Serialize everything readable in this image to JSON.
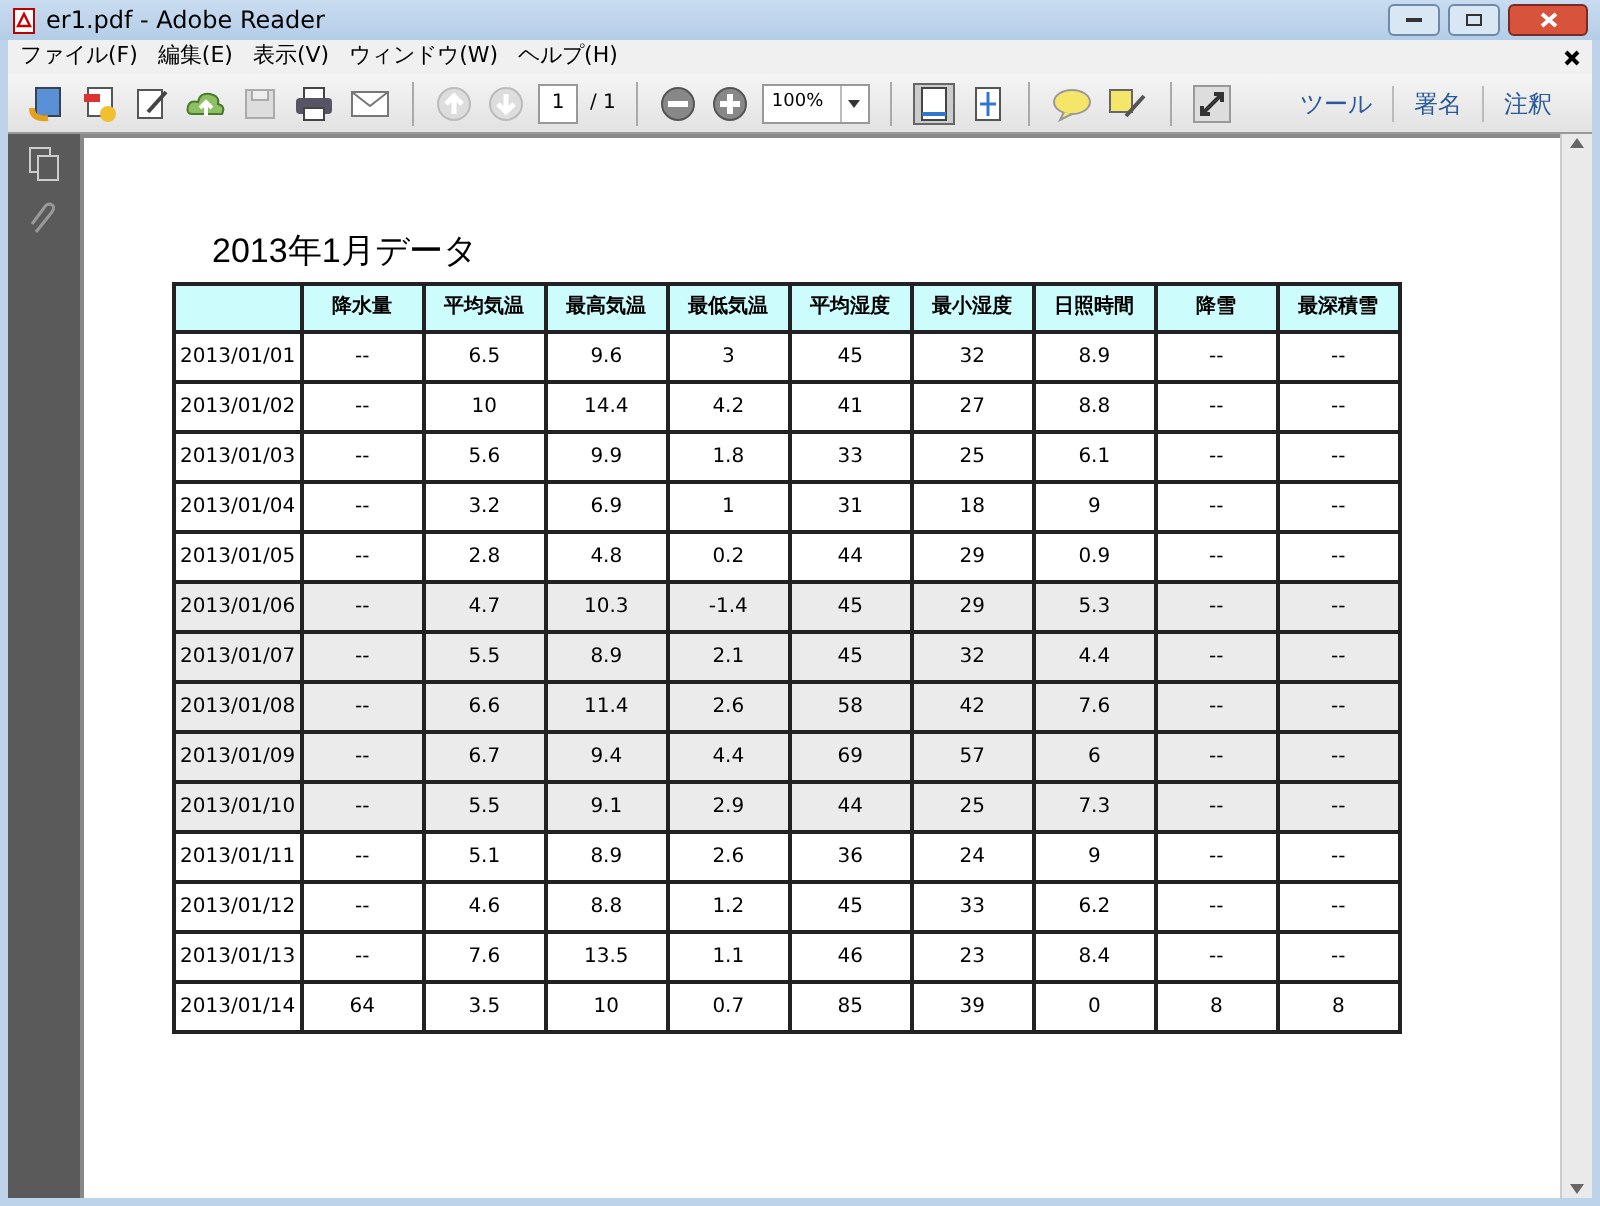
{
  "window": {
    "title": "er1.pdf - Adobe Reader"
  },
  "menu": [
    "ファイル(F)",
    "編集(E)",
    "表示(V)",
    "ウィンドウ(W)",
    "ヘルプ(H)"
  ],
  "toolbar": {
    "page": "1",
    "page_total": "/ 1",
    "zoom": "100%",
    "panels": [
      "ツール",
      "署名",
      "注釈"
    ]
  },
  "document": {
    "title": "2013年1月データ",
    "table": {
      "columns": [
        "",
        "降水量",
        "平均気温",
        "最高気温",
        "最低気温",
        "平均湿度",
        "最小湿度",
        "日照時間",
        "降雪",
        "最深積雪"
      ],
      "rows": [
        {
          "highlighted": false,
          "cells": [
            "2013/01/01",
            "--",
            "6.5",
            "9.6",
            "3",
            "45",
            "32",
            "8.9",
            "--",
            "--"
          ]
        },
        {
          "highlighted": false,
          "cells": [
            "2013/01/02",
            "--",
            "10",
            "14.4",
            "4.2",
            "41",
            "27",
            "8.8",
            "--",
            "--"
          ]
        },
        {
          "highlighted": false,
          "cells": [
            "2013/01/03",
            "--",
            "5.6",
            "9.9",
            "1.8",
            "33",
            "25",
            "6.1",
            "--",
            "--"
          ]
        },
        {
          "highlighted": false,
          "cells": [
            "2013/01/04",
            "--",
            "3.2",
            "6.9",
            "1",
            "31",
            "18",
            "9",
            "--",
            "--"
          ]
        },
        {
          "highlighted": false,
          "cells": [
            "2013/01/05",
            "--",
            "2.8",
            "4.8",
            "0.2",
            "44",
            "29",
            "0.9",
            "--",
            "--"
          ]
        },
        {
          "highlighted": true,
          "cells": [
            "2013/01/06",
            "--",
            "4.7",
            "10.3",
            "-1.4",
            "45",
            "29",
            "5.3",
            "--",
            "--"
          ]
        },
        {
          "highlighted": true,
          "cells": [
            "2013/01/07",
            "--",
            "5.5",
            "8.9",
            "2.1",
            "45",
            "32",
            "4.4",
            "--",
            "--"
          ]
        },
        {
          "highlighted": true,
          "cells": [
            "2013/01/08",
            "--",
            "6.6",
            "11.4",
            "2.6",
            "58",
            "42",
            "7.6",
            "--",
            "--"
          ]
        },
        {
          "highlighted": true,
          "cells": [
            "2013/01/09",
            "--",
            "6.7",
            "9.4",
            "4.4",
            "69",
            "57",
            "6",
            "--",
            "--"
          ]
        },
        {
          "highlighted": true,
          "cells": [
            "2013/01/10",
            "--",
            "5.5",
            "9.1",
            "2.9",
            "44",
            "25",
            "7.3",
            "--",
            "--"
          ]
        },
        {
          "highlighted": false,
          "cells": [
            "2013/01/11",
            "--",
            "5.1",
            "8.9",
            "2.6",
            "36",
            "24",
            "9",
            "--",
            "--"
          ]
        },
        {
          "highlighted": false,
          "cells": [
            "2013/01/12",
            "--",
            "4.6",
            "8.8",
            "1.2",
            "45",
            "33",
            "6.2",
            "--",
            "--"
          ]
        },
        {
          "highlighted": false,
          "cells": [
            "2013/01/13",
            "--",
            "7.6",
            "13.5",
            "1.1",
            "46",
            "23",
            "8.4",
            "--",
            "--"
          ]
        },
        {
          "highlighted": false,
          "cells": [
            "2013/01/14",
            "64",
            "3.5",
            "10",
            "0.7",
            "85",
            "39",
            "0",
            "8",
            "8"
          ]
        }
      ]
    }
  }
}
